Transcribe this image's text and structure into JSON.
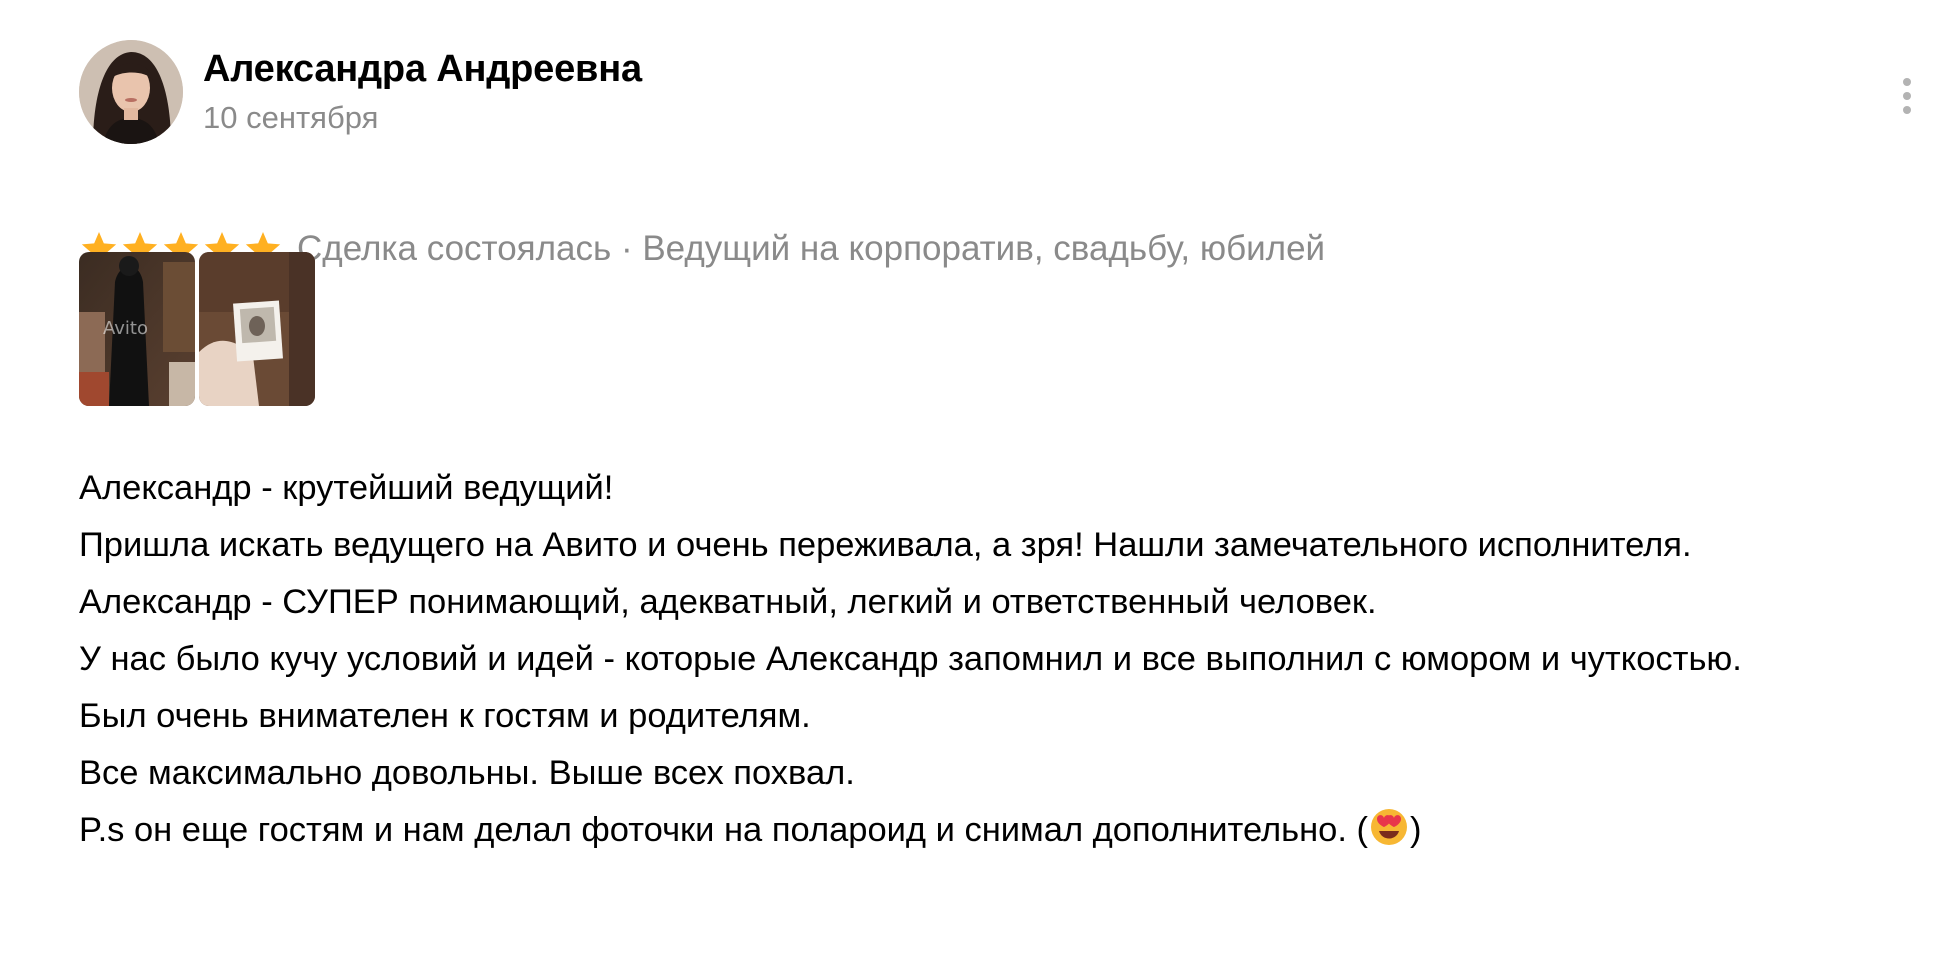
{
  "review": {
    "author": {
      "name": "Александра Андреевна",
      "avatar_icon": "user-avatar-photo"
    },
    "date": "10 сентября",
    "rating": 5,
    "rating_max": 5,
    "meta": "Сделка состоялась · Ведущий на корпоратив, свадьбу, юбилей",
    "star_color": "#ffb021",
    "menu_icon": "more-vertical-icon",
    "photos": [
      {
        "icon": "photo-thumbnail",
        "watermark": "Avito"
      },
      {
        "icon": "photo-thumbnail"
      }
    ],
    "paragraphs": [
      "Александр - крутейший ведущий!",
      "Пришла искать ведущего на Авито и очень переживала, а зря! Нашли замечательного исполнителя.",
      "Александр - СУПЕР понимающий, адекватный, легкий и ответственный человек.",
      "У нас было кучу условий и идей - которые Александр запомнил и все выполнил с юмором и чуткостью.",
      "Был очень внимателен к гостям и родителям.",
      "Все максимально довольны. Выше всех похвал."
    ],
    "last_paragraph": {
      "before_emoji": "P.s он еще гостям и нам делал фоточки на полароид и снимал дополнительно. (",
      "emoji_icon": "heart-eyes-emoji",
      "after_emoji": ")"
    }
  }
}
